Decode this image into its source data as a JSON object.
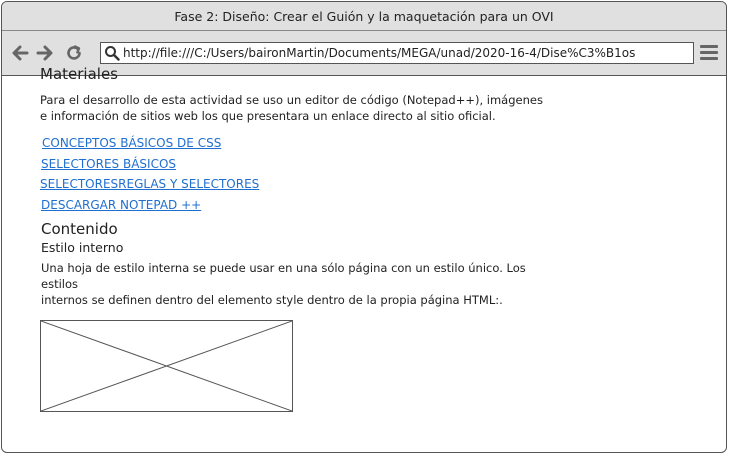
{
  "window": {
    "title": "Fase 2: Diseño: Crear el Guión y la maquetación para un OVI"
  },
  "navbar": {
    "url": "http://file:///C:/Users/baironMartin/Documents/MEGA/unad/2020-16-4/Dise%C3%B1os",
    "icons": [
      "back-arrow-icon",
      "forward-arrow-icon",
      "reload-icon",
      "search-icon",
      "hamburger-menu-icon"
    ]
  },
  "main": {
    "materiales_heading": "Materiales",
    "materiales_text_1": "Para el desarrollo de esta actividad se uso un editor de código (Notepad++), imágenes",
    "materiales_text_2": "e información de sitios web los que presentara un enlace directo al sitio oficial.",
    "links": [
      "CONCEPTOS BÁSICOS DE CSS",
      "SELECTORES BÁSICOS",
      "SELECTORESREGLAS Y SELECTORES",
      "DESCARGAR NOTEPAD ++"
    ],
    "contenido_heading": "Contenido",
    "estilo_subheading": "Estilo interno",
    "estilo_text_1": "Una hoja de estilo interna se puede usar en una sólo página con un estilo único. Los",
    "estilo_text_2": "estilos",
    "estilo_text_3": "internos se definen dentro del elemento style dentro de la propia página HTML:."
  },
  "colors": {
    "link": "#1f6fd0",
    "chrome": "#e0e0e0",
    "border": "#555555"
  }
}
